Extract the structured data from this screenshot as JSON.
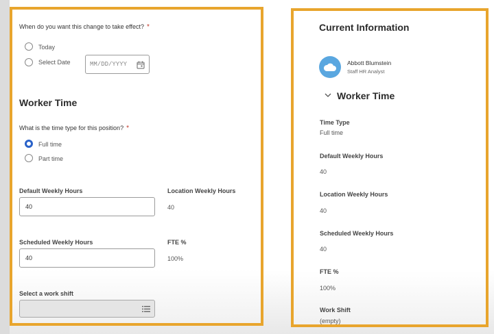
{
  "effective_date": {
    "question": "When do you want this change to take effect?",
    "required_mark": "*",
    "options": [
      {
        "label": "Today",
        "checked": false
      },
      {
        "label": "Select Date",
        "checked": false
      }
    ],
    "date_placeholder": "MM/DD/YYYY"
  },
  "worker_time_form": {
    "title": "Worker Time",
    "time_type_question": "What is the time type for this position?",
    "required_mark": "*",
    "time_type_options": [
      {
        "label": "Full time",
        "checked": true
      },
      {
        "label": "Part time",
        "checked": false
      }
    ],
    "default_weekly_hours": {
      "label": "Default Weekly Hours",
      "value": "40"
    },
    "location_weekly_hours": {
      "label": "Location Weekly Hours",
      "value": "40"
    },
    "scheduled_weekly_hours": {
      "label": "Scheduled Weekly Hours",
      "value": "40"
    },
    "fte": {
      "label": "FTE %",
      "value": "100%"
    },
    "work_shift": {
      "label": "Select a work shift",
      "value": ""
    }
  },
  "current_information": {
    "title": "Current Information",
    "worker": {
      "name": "Abbott Blumstein",
      "role": "Staff HR Analyst"
    },
    "section_title": "Worker Time",
    "fields": [
      {
        "label": "Time Type",
        "value": "Full time"
      },
      {
        "label": "Default Weekly Hours",
        "value": "40"
      },
      {
        "label": "Location Weekly Hours",
        "value": "40"
      },
      {
        "label": "Scheduled Weekly Hours",
        "value": "40"
      },
      {
        "label": "FTE %",
        "value": "100%"
      },
      {
        "label": "Work Shift",
        "value": "(empty)"
      }
    ]
  },
  "colors": {
    "highlight_border": "#e8a52d",
    "radio_selected": "#2a62c9",
    "required": "#c0392b",
    "avatar": "#5aa7e0"
  }
}
